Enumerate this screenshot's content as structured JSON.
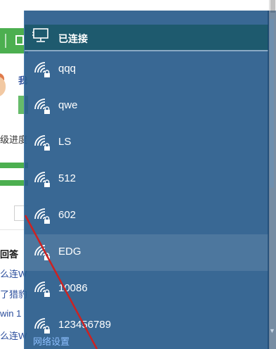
{
  "background": {
    "link_fragment": "我",
    "progress_label": "级进度",
    "answers_label": "回答",
    "questions": [
      "么连W",
      "了猎豹",
      "win 1",
      "么连W"
    ]
  },
  "network_panel": {
    "header": {
      "icon": "network-monitor-icon",
      "label": "已连接"
    },
    "networks": [
      {
        "name": "qqq",
        "icon": "wifi-secured-icon"
      },
      {
        "name": "qwe",
        "icon": "wifi-secured-icon"
      },
      {
        "name": "LS",
        "icon": "wifi-secured-icon"
      },
      {
        "name": "512",
        "icon": "wifi-secured-icon"
      },
      {
        "name": "602",
        "icon": "wifi-secured-icon"
      },
      {
        "name": "EDG",
        "icon": "wifi-secured-icon"
      },
      {
        "name": "10086",
        "icon": "wifi-secured-icon"
      },
      {
        "name": "123456789",
        "icon": "wifi-secured-icon"
      }
    ],
    "footer_link": "网络设置",
    "hovered_network": "EDG"
  },
  "colors": {
    "panel_bg": "#2a5d8c",
    "header_bg": "#1e5a6e",
    "accent_green": "#4caf50",
    "annotation_red": "#cc2222"
  }
}
